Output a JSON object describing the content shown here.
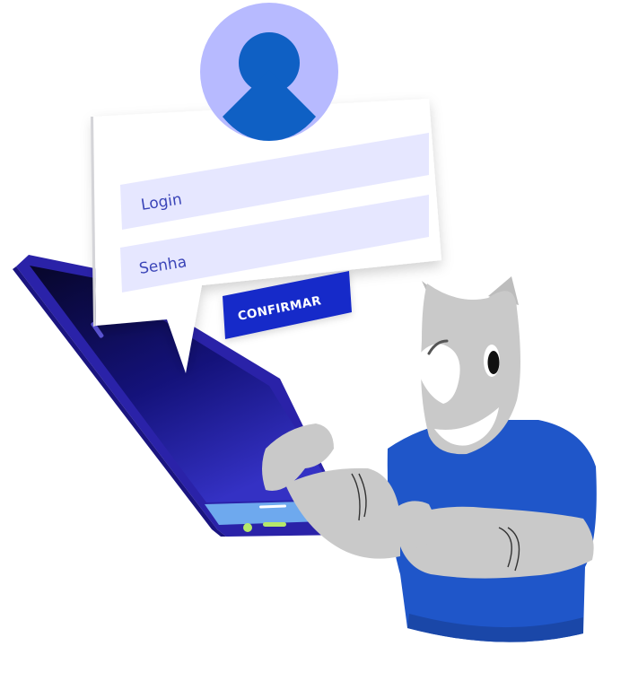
{
  "login_card": {
    "login_placeholder": "Login",
    "password_placeholder": "Senha",
    "confirm_label": "CONFIRMAR"
  },
  "avatar": {
    "icon": "user-silhouette-icon"
  },
  "colors": {
    "avatar_bg": "#b7baff",
    "avatar_fg": "#0f60c4",
    "field_bg": "#e6e7ff",
    "field_text": "#3b45b8",
    "button_bg": "#1629c9",
    "button_text": "#ffffff",
    "phone_frame": "#2a22a8",
    "phone_screen_top": "#0b0a33",
    "phone_screen_bottom": "#2b27b0",
    "phone_nav": "#6ea9ee",
    "rhino_skin": "#c9c9c9",
    "rhino_shirt": "#1f56c9"
  }
}
